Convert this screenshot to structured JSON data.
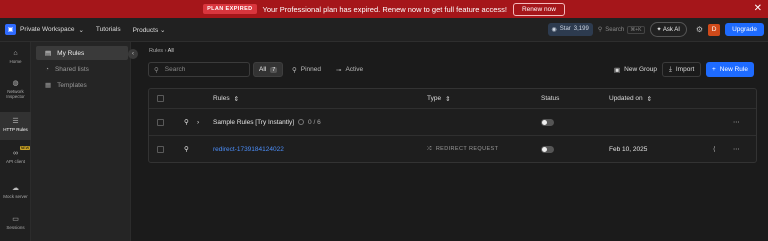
{
  "banner": {
    "badge": "PLAN EXPIRED",
    "message": "Your Professional plan has expired. Renew now to get full feature access!",
    "renew_label": "Renew now"
  },
  "topbar": {
    "workspace": "Private Workspace",
    "nav": [
      "Tutorials",
      "Products"
    ],
    "github_label": "Star",
    "github_count": "3,199",
    "search_label": "Search",
    "search_shortcut": "⌘+K",
    "ask_ai": "Ask AI",
    "avatar_initial": "D",
    "upgrade_label": "Upgrade"
  },
  "leftnav": [
    {
      "label": "Home",
      "icon": "home-icon"
    },
    {
      "label": "Network Inspector",
      "icon": "globe-icon"
    },
    {
      "label": "HTTP Rules",
      "icon": "sliders-icon"
    },
    {
      "label": "API client",
      "icon": "link-icon",
      "badge": "NEW"
    },
    {
      "label": "Mock server",
      "icon": "cloud-icon"
    },
    {
      "label": "Sessions",
      "icon": "video-icon"
    }
  ],
  "subnav": [
    {
      "label": "My Rules",
      "icon": "folder-icon"
    },
    {
      "label": "Shared lists",
      "icon": "share-icon"
    },
    {
      "label": "Templates",
      "icon": "template-icon"
    }
  ],
  "main": {
    "breadcrumb": [
      "Rules",
      "All"
    ],
    "search_placeholder": "Search",
    "filters": {
      "all_label": "All",
      "all_count": "7",
      "pinned": "Pinned",
      "active": "Active"
    },
    "actions": {
      "new_group": "New Group",
      "import": "Import",
      "new_rule": "New Rule"
    },
    "columns": {
      "rules": "Rules",
      "type": "Type",
      "status": "Status",
      "updated": "Updated on"
    },
    "rows": [
      {
        "name": "Sample Rules [Try Instantly]",
        "count": "0 / 6",
        "type": "",
        "updated": ""
      },
      {
        "name": "redirect-1739184124022",
        "type": "REDIRECT REQUEST",
        "updated": "Feb 10, 2025"
      }
    ]
  },
  "colors": {
    "brand_blue": "#1e6bff",
    "banner_red": "#a5161a",
    "link": "#4b8df8"
  }
}
